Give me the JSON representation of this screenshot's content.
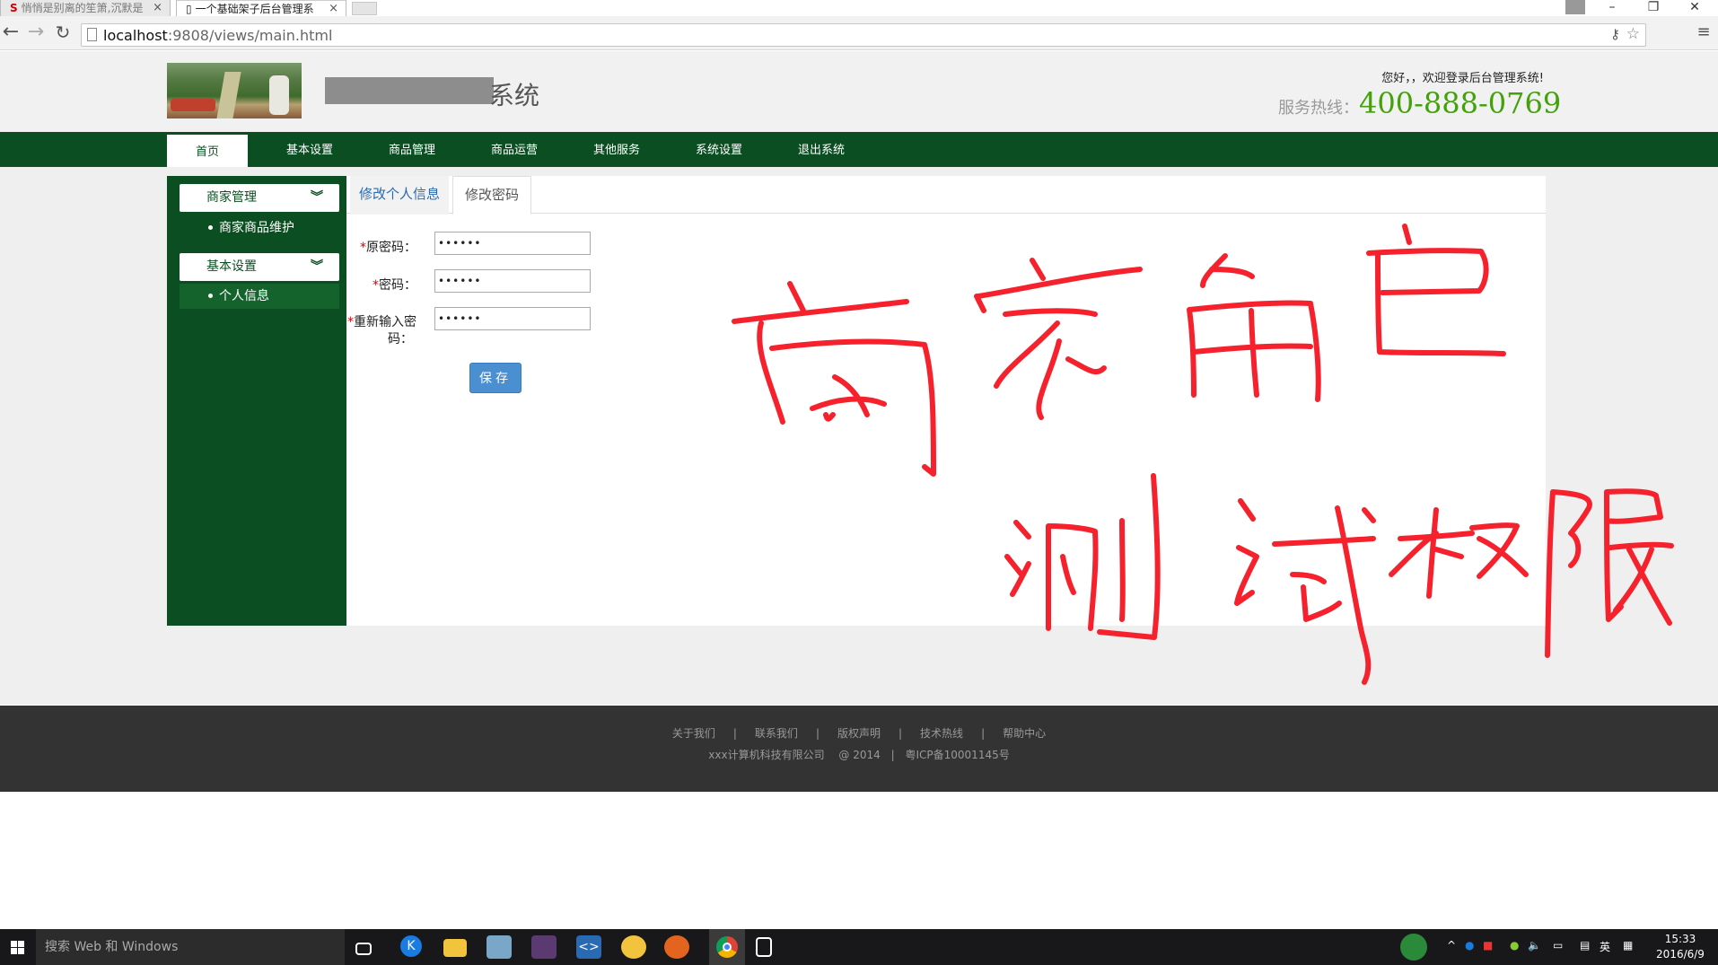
{
  "browser": {
    "tabs": [
      {
        "title": "悄悄是别离的笙箫,沉默是"
      },
      {
        "title": "一个基础架子后台管理系"
      }
    ],
    "url_host": "localhost",
    "url_rest": ":9808/views/main.html"
  },
  "header": {
    "title_suffix": "系统",
    "welcome": "您好，，欢迎登录后台管理系统!",
    "hotline_label": "服务热线：",
    "hotline_number": "400-888-0769"
  },
  "nav": {
    "items": [
      "首页",
      "基本设置",
      "商品管理",
      "商品运营",
      "其他服务",
      "系统设置",
      "退出系统"
    ]
  },
  "sidebar": {
    "groups": [
      {
        "label": "商家管理",
        "items": [
          "商家商品维护"
        ]
      },
      {
        "label": "基本设置",
        "items": [
          "个人信息"
        ]
      }
    ]
  },
  "tabs": [
    "修改个人信息",
    "修改密码"
  ],
  "form": {
    "old_password_label": "原密码：",
    "new_password_label": "密码：",
    "confirm_label_1": "重新输入密",
    "confirm_label_2": "码：",
    "required_mark": "*",
    "old_password_value": "••••••",
    "new_password_value": "••••••",
    "confirm_value": "••••••",
    "save_label": "保存"
  },
  "footer": {
    "links": [
      "关于我们",
      "联系我们",
      "版权声明",
      "技术热线",
      "帮助中心"
    ],
    "separator": "|",
    "company": "xxx计算机科技有限公司",
    "copyright": "@ 2014",
    "icp": "粤ICP备10001145号"
  },
  "annotation": {
    "line1": "商家角色",
    "line2": "测试权限",
    "color": "#f5222d"
  },
  "taskbar": {
    "search_placeholder": "搜索 Web 和 Windows",
    "ime": "英",
    "time": "15:33",
    "date": "2016/6/9"
  },
  "colors": {
    "brand_green": "#0b4e21",
    "hotline_green": "#43a10a",
    "button_blue": "#4a8fd0"
  }
}
